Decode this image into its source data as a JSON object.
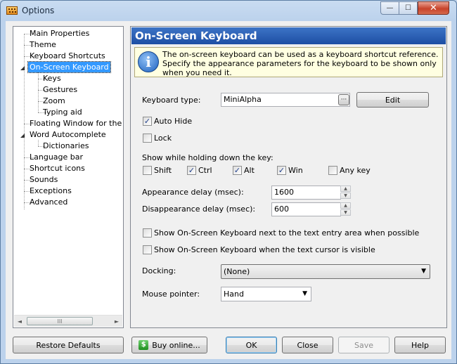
{
  "window": {
    "title": "Options",
    "min_glyph": "—",
    "max_glyph": "☐",
    "close_glyph": "✕"
  },
  "tree": {
    "items": [
      {
        "label": "Main Properties"
      },
      {
        "label": "Theme"
      },
      {
        "label": "Keyboard Shortcuts"
      },
      {
        "label": "On-Screen Keyboard",
        "expander": "◢"
      },
      {
        "label": "Keys"
      },
      {
        "label": "Gestures"
      },
      {
        "label": "Zoom"
      },
      {
        "label": "Typing aid"
      },
      {
        "label": "Floating Window for the On-"
      },
      {
        "label": "Word Autocomplete",
        "expander": "◢"
      },
      {
        "label": "Dictionaries"
      },
      {
        "label": "Language bar"
      },
      {
        "label": "Shortcut icons"
      },
      {
        "label": "Sounds"
      },
      {
        "label": "Exceptions"
      },
      {
        "label": "Advanced"
      }
    ],
    "scroll_left": "◄",
    "scroll_right": "►",
    "thumb_grip": "III"
  },
  "panel": {
    "title": "On-Screen Keyboard",
    "info_icon": "i",
    "info_text": "The on-screen keyboard can be used as a keyboard shortcut reference. Specify the appearance parameters for the keyboard to be shown only when you need it.",
    "keyboard_type_label": "Keyboard type:",
    "keyboard_type_value": "MiniAlpha",
    "browse_label": "···",
    "edit_label": "Edit",
    "auto_hide_label": "Auto Hide",
    "lock_label": "Lock",
    "hold_key_label": "Show while holding down the key:",
    "keys": [
      {
        "label": "Shift",
        "checked": false
      },
      {
        "label": "Ctrl",
        "checked": true
      },
      {
        "label": "Alt",
        "checked": true
      },
      {
        "label": "Win",
        "checked": true
      },
      {
        "label": "Any key",
        "checked": false
      }
    ],
    "appearance_delay_label": "Appearance delay (msec):",
    "appearance_delay_value": "1600",
    "disappearance_delay_label": "Disappearance delay (msec):",
    "disappearance_delay_value": "600",
    "show_next_to_entry_label": "Show On-Screen Keyboard next to the text entry area when possible",
    "show_cursor_visible_label": "Show On-Screen Keyboard when the text cursor is visible",
    "docking_label": "Docking:",
    "docking_value": "(None)",
    "mouse_pointer_label": "Mouse pointer:",
    "mouse_pointer_value": "Hand",
    "check_glyph": "✓",
    "dropdown_glyph": "▼",
    "spin_up": "▲",
    "spin_down": "▼"
  },
  "buttons": {
    "restore_defaults": "Restore Defaults",
    "buy_icon": "$",
    "buy_online": "Buy online...",
    "ok": "OK",
    "close": "Close",
    "save": "Save",
    "help": "Help"
  }
}
